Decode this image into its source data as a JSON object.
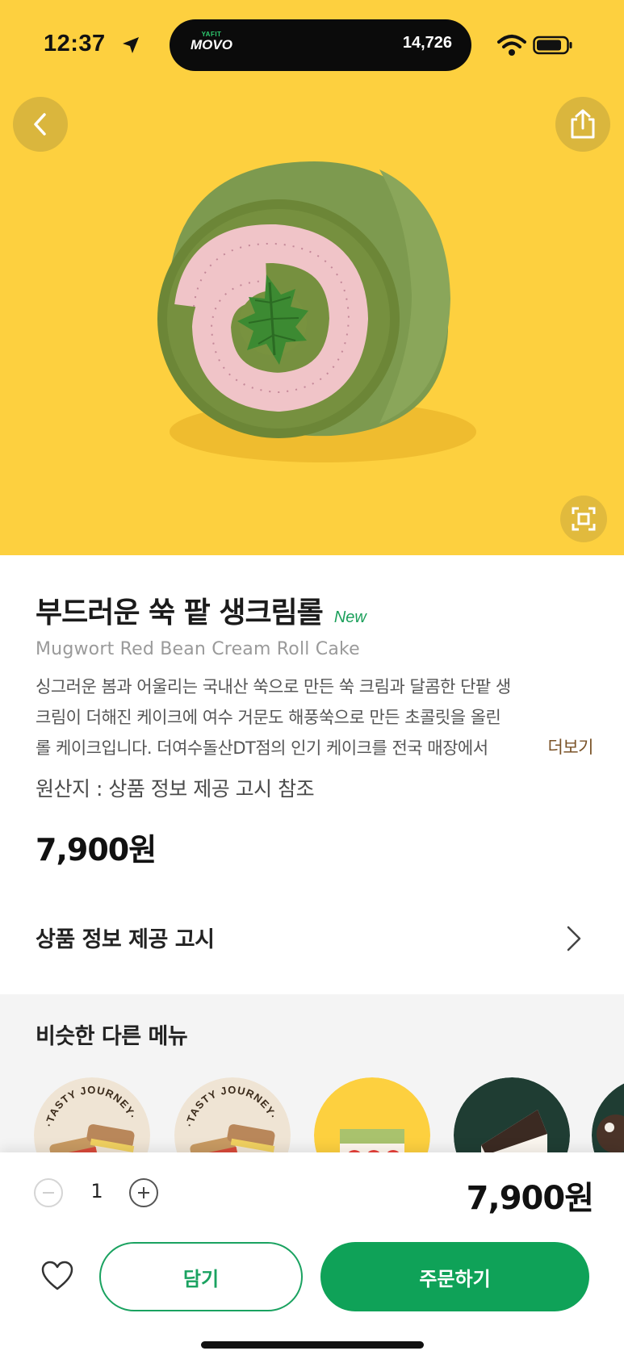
{
  "status_bar": {
    "time": "12:37",
    "island_brand_small": "YAFIT",
    "island_brand": "MOVO",
    "steps": "14,726"
  },
  "hero": {
    "background_color": "#fdd03f",
    "back_icon": "chevron-left-icon",
    "share_icon": "share-icon",
    "zoom_icon": "fullscreen-icon"
  },
  "product": {
    "name": "부드러운 쑥 팥 생크림롤",
    "badge": "New",
    "name_en": "Mugwort Red Bean Cream Roll Cake",
    "description_lines": [
      "싱그러운 봄과 어울리는 국내산 쑥으로 만든 쑥 크림과 달콤한 단팥 생",
      "크림이 더해진 케이크에 여수 거문도 해풍쑥으로 만든 초콜릿을 올린",
      "롤 케이크입니다. 더여수돌산DT점의 인기 케이크를 전국 매장에서"
    ],
    "more_label": "더보기",
    "origin": "원산지 : 상품 정보 제공 고시 참조",
    "price": "7,900원"
  },
  "notice": {
    "label": "상품 정보 제공 고시"
  },
  "similar": {
    "title": "비슷한 다른 메뉴",
    "items": [
      {
        "name": "tasty-journey-sandwich",
        "caption": "TASTY JOURNEY",
        "bg": "#efe4d4"
      },
      {
        "name": "tasty-journey-sandwich-2",
        "caption": "TASTY JOURNEY",
        "bg": "#efe4d4"
      },
      {
        "name": "strawberry-matcha-cake",
        "bg": "#fdd03f"
      },
      {
        "name": "strawberry-shortcake",
        "bg": "#1f3d33"
      },
      {
        "name": "chocolate-cake",
        "bg": "#1f3d33"
      }
    ]
  },
  "order_bar": {
    "quantity": "1",
    "total": "7,900원",
    "cart_label": "담기",
    "order_label": "주문하기",
    "accent_color": "#0fa258"
  }
}
